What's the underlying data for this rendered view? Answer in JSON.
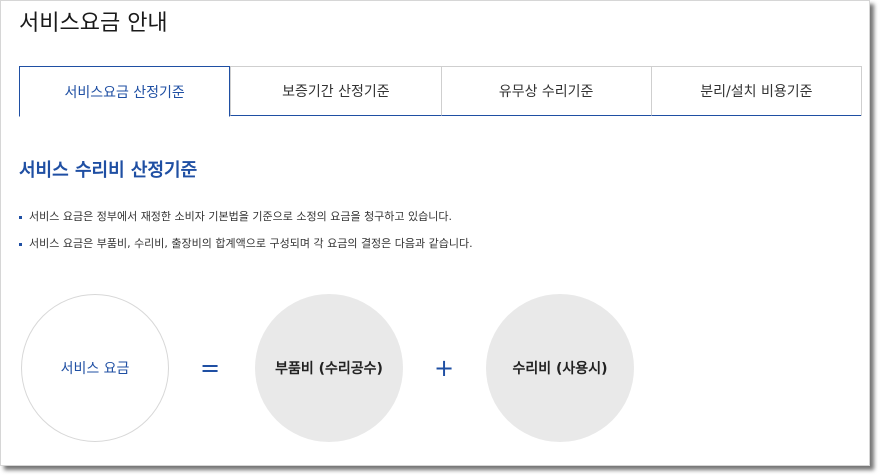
{
  "page": {
    "title": "서비스요금 안내"
  },
  "tabs": [
    {
      "label": "서비스요금 산정기준",
      "active": true
    },
    {
      "label": "보증기간 산정기준",
      "active": false
    },
    {
      "label": "유무상 수리기준",
      "active": false
    },
    {
      "label": "분리/설치 비용기준",
      "active": false
    }
  ],
  "section": {
    "title": "서비스 수리비 산정기준",
    "bullets": [
      "서비스 요금은 정부에서 재정한 소비자 기본법을 기준으로 소정의 요금을 청구하고 있습니다.",
      "서비스 요금은 부품비, 수리비, 출장비의 합계액으로 구성되며 각 요금의 결정은 다음과 같습니다."
    ]
  },
  "formula": {
    "total": "서비스 요금",
    "equals": "=",
    "part1": "부품비 (수리공수)",
    "plus": "+",
    "part2": "수리비 (사용시)"
  },
  "colors": {
    "accent": "#1f4fa3",
    "circle_fill": "#e9e9e9",
    "border": "#cfcfcf"
  }
}
